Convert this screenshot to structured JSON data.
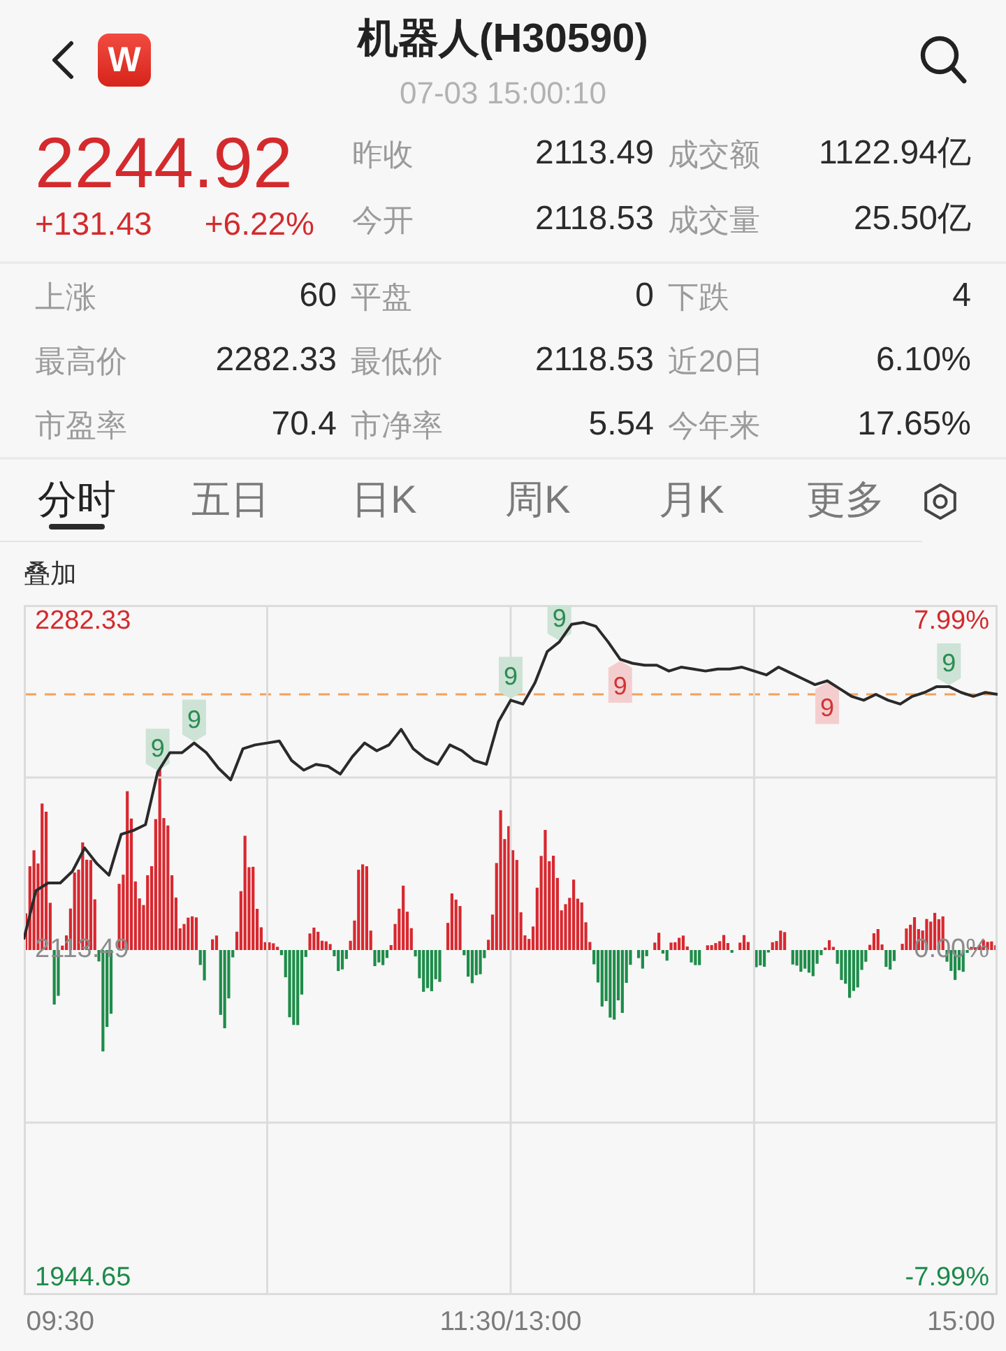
{
  "header": {
    "logo": "W",
    "title": "机器人(H30590)",
    "timestamp": "07-03 15:00:10"
  },
  "quote": {
    "price": "2244.92",
    "change": "+131.43",
    "change_percent": "+6.22%",
    "rising": true
  },
  "summary": [
    {
      "label": "昨收",
      "value": "2113.49"
    },
    {
      "label": "成交额",
      "value": "1122.94亿"
    },
    {
      "label": "今开",
      "value": "2118.53"
    },
    {
      "label": "成交量",
      "value": "25.50亿"
    }
  ],
  "stats": [
    {
      "label": "上涨",
      "value": "60"
    },
    {
      "label": "平盘",
      "value": "0"
    },
    {
      "label": "下跌",
      "value": "4"
    },
    {
      "label": "最高价",
      "value": "2282.33"
    },
    {
      "label": "最低价",
      "value": "2118.53"
    },
    {
      "label": "近20日",
      "value": "6.10%"
    },
    {
      "label": "市盈率",
      "value": "70.4"
    },
    {
      "label": "市净率",
      "value": "5.54"
    },
    {
      "label": "今年来",
      "value": "17.65%"
    }
  ],
  "tabs": [
    {
      "label": "分时",
      "selected": true
    },
    {
      "label": "五日",
      "selected": false
    },
    {
      "label": "日K",
      "selected": false
    },
    {
      "label": "周K",
      "selected": false
    },
    {
      "label": "月K",
      "selected": false
    },
    {
      "label": "更多",
      "selected": false
    }
  ],
  "chart": {
    "overlay_label": "叠加",
    "percent_labels": [
      "7.99%",
      "0.00%",
      "-7.99%"
    ],
    "tags": [
      {
        "text": "9",
        "color": "#2b8c52"
      },
      {
        "text": "9",
        "color": "#2b8c52"
      },
      {
        "text": "9",
        "color": "#2b8c52"
      },
      {
        "text": "9",
        "color": "#2b8c52"
      },
      {
        "text": "9",
        "color": "#d23434"
      },
      {
        "text": "9",
        "color": "#d23434"
      },
      {
        "text": "9",
        "color": "#2b8c52"
      }
    ],
    "chart_data": {
      "type": "line",
      "categories": [
        null,
        null,
        null,
        "09:30",
        null,
        null,
        null,
        null,
        null,
        null,
        null,
        null,
        null,
        null,
        null,
        null,
        null,
        null,
        null,
        null,
        null,
        null,
        null,
        null,
        null,
        null,
        null,
        null,
        null,
        null,
        null,
        null,
        null,
        null,
        null,
        null,
        null,
        null,
        null,
        null,
        "11:30/13:00",
        null,
        null,
        null,
        null,
        null,
        null,
        null,
        null,
        null,
        null,
        null,
        null,
        null,
        null,
        null,
        null,
        null,
        null,
        null,
        null,
        null,
        null,
        null,
        null,
        null,
        null,
        null,
        null,
        null,
        null,
        null,
        null,
        null,
        null,
        null,
        null,
        "15:00",
        null,
        null,
        null
      ],
      "values": [
        2119,
        2144,
        2148,
        2148,
        2154,
        2166,
        2158,
        2152,
        2173,
        2175,
        2178,
        2205,
        2215,
        2215,
        2220,
        2215,
        2207,
        2201,
        2217,
        2219,
        2220,
        2221,
        2211,
        2206,
        2209,
        2208,
        2204,
        2213,
        2220,
        2216,
        2219,
        2227,
        2217,
        2212,
        2209,
        2219,
        2216,
        2211,
        2209,
        2231,
        2242,
        2240,
        2251,
        2267,
        2272,
        2281,
        2282,
        2280,
        2272,
        2263,
        2261,
        2260,
        2260,
        2257,
        2259,
        2258,
        2257,
        2258,
        2258,
        2259,
        2257,
        2255,
        2259,
        2256,
        2253,
        2250,
        2252,
        2248,
        2244,
        2242,
        2245,
        2242,
        2240,
        2244,
        2246,
        2249,
        2249,
        2246,
        2244,
        2246,
        2245
      ],
      "ylim": [
        1936,
        2291
      ],
      "yticks": [
        {
          "value": 2282.33,
          "label": "2282.33"
        },
        {
          "value": 2113.49,
          "label": "2113.49"
        },
        {
          "value": 1944.65,
          "label": "1944.65"
        }
      ],
      "grid": true
    }
  }
}
